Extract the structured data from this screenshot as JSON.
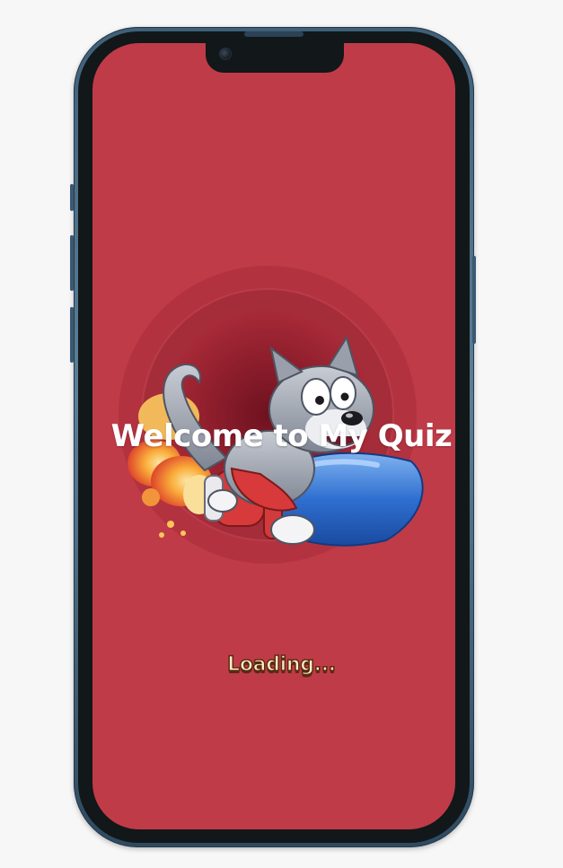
{
  "screen": {
    "title": "Welcome to My Quiz",
    "loading_text": "Loading...",
    "background_color": "#c03b48",
    "hero_image": "cat-riding-rocket-illustration"
  },
  "device": {
    "frame": "phone",
    "frame_color": "#3f6078"
  }
}
